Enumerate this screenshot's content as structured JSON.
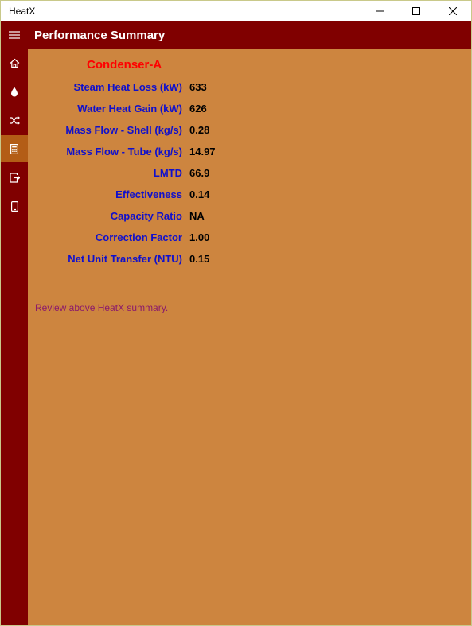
{
  "window": {
    "title": "HeatX"
  },
  "header": {
    "title": "Performance Summary"
  },
  "summary": {
    "heading": "Condenser-A",
    "rows": [
      {
        "label": "Steam Heat Loss (kW)",
        "value": "633"
      },
      {
        "label": "Water Heat Gain (kW)",
        "value": "626"
      },
      {
        "label": "Mass Flow - Shell (kg/s)",
        "value": "0.28"
      },
      {
        "label": "Mass Flow - Tube (kg/s)",
        "value": "14.97"
      },
      {
        "label": "LMTD",
        "value": "66.9"
      },
      {
        "label": "Effectiveness",
        "value": "0.14"
      },
      {
        "label": "Capacity Ratio",
        "value": "NA"
      },
      {
        "label": "Correction Factor",
        "value": "1.00"
      },
      {
        "label": "Net Unit Transfer (NTU)",
        "value": "0.15"
      }
    ],
    "note": "Review above HeatX summary."
  },
  "sidebar": {
    "items": [
      {
        "icon": "home-icon"
      },
      {
        "icon": "droplet-icon"
      },
      {
        "icon": "shuffle-icon"
      },
      {
        "icon": "calculator-icon",
        "active": true
      },
      {
        "icon": "export-icon"
      },
      {
        "icon": "phone-icon"
      }
    ]
  },
  "colors": {
    "header": "#800000",
    "sidebar_active": "#b35d16",
    "content_bg": "#cd853f",
    "heading": "#ff0000",
    "label": "#1010cc",
    "note": "#8b1a6b"
  }
}
